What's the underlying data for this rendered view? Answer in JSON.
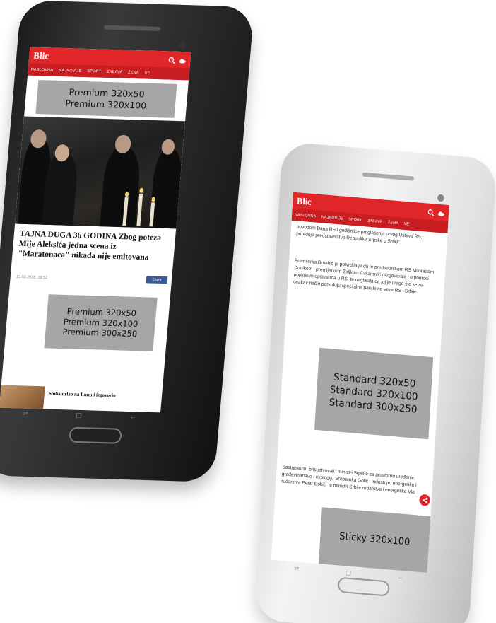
{
  "left_phone": {
    "logo": "Blic",
    "nav": [
      "NASLOVNA",
      "NAJNOVIJE",
      "SPORT",
      "ZABAVA",
      "ŽENA",
      "VE"
    ],
    "ad_top": [
      "Premium 320x50",
      "Premium 320x100"
    ],
    "headline": "TAJNA DUGA 36 GODINA Zbog poteza Mije Aleksića jedna scena iz \"Maratonaca\" nikada nije emitovana",
    "timestamp": "15.03.2018. 13:52",
    "share_label": "Share",
    "ad_mid": [
      "Premium 320x50",
      "Premium 320x100",
      "Premium 300x250"
    ],
    "teaser": "Sloba urlao na Lunu i izgovorio"
  },
  "right_phone": {
    "logo": "Blic",
    "nav": [
      "NASLOVNA",
      "NAJNOVIJE",
      "SPORT",
      "ZABAVA",
      "ŽENA",
      "VE"
    ],
    "paragraph_1": "povodom Dana RS i godišnjice proglašenja prvog Ustava RS, priređuje predstavništvo Republike Srpske u Srbiji\".",
    "paragraph_2": "Premijerka Brnabić je potvrdila je da je predsednikom RS Miloradom Dodikom i premijerkom Željkom Cvijanović razgovarala i o pomoći pojedinim opštinama u RS, te naglasila da joj je drago što se na ovakav način potvrđuju specijalne paralelne veze RS i Srbije.",
    "ad_standard": [
      "Standard 320x50",
      "Standard 320x100",
      "Standard 300x250"
    ],
    "paragraph_3": "Sastanku su prisustvovali i ministri Srpske za prostorno uređenje, građevinarstvo i ekologiju Srebrenka Golić i industrije, energetike i rudarstva Petar Đokić, te ministri Srbije rudarstva i energetike Vla",
    "sticky_ad": "Sticky 320x100",
    "close_symbol": "✕"
  },
  "colors": {
    "brand_red": "#e1262a",
    "ad_gray": "#a6a6a6"
  }
}
